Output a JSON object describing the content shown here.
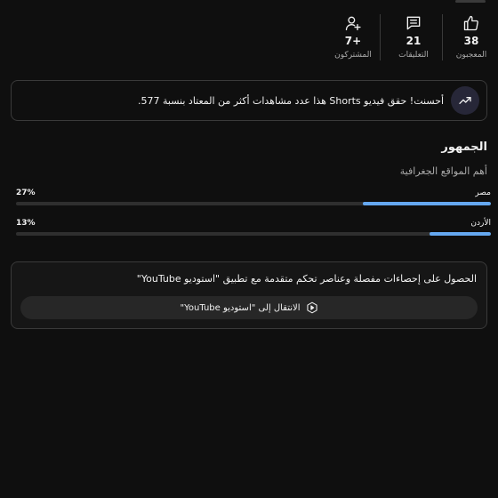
{
  "stats": [
    {
      "icon": "thumbs-up-icon",
      "value": "38",
      "label": "المعجبون"
    },
    {
      "icon": "comment-icon",
      "value": "21",
      "label": "التعليقات"
    },
    {
      "icon": "person-add-icon",
      "value": "+7",
      "label": "المشتركون"
    }
  ],
  "insight": {
    "icon": "trending-up-icon",
    "text": "أحسنت! حقق فيديو Shorts هذا عدد مشاهدات أكثر من المعتاد بنسبة 577."
  },
  "audience": {
    "title": "الجمهور",
    "subtitle": "أهم المواقع الجغرافية",
    "locations": [
      {
        "name": "مصر",
        "percent_label": "27%",
        "percent": 27
      },
      {
        "name": "الأردن",
        "percent_label": "13%",
        "percent": 13
      }
    ]
  },
  "studio": {
    "heading": "الحصول على إحصاءات مفصلة وعناصر تحكم متقدمة مع تطبيق \"استوديو YouTube\"",
    "button_label": "الانتقال إلى \"استوديو YouTube\"",
    "button_icon": "youtube-studio-icon"
  },
  "colors": {
    "background": "#0f0f0f",
    "bar_fill": "#65a8f0",
    "bar_track": "#2f2f2f",
    "insight_badge": "#272738"
  }
}
